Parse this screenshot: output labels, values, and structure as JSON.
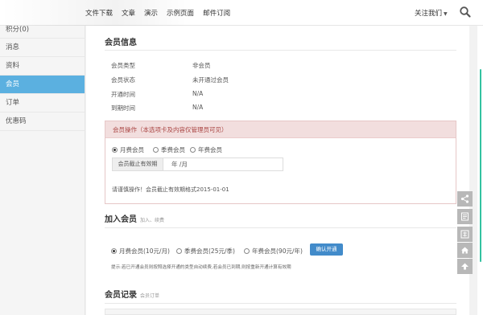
{
  "nav": {
    "items": [
      "文件下载",
      "文章",
      "演示",
      "示例页面",
      "邮件订阅"
    ],
    "follow": "关注我们"
  },
  "sidebar": {
    "items": [
      {
        "label": "积分(0)"
      },
      {
        "label": "消息"
      },
      {
        "label": "资料"
      },
      {
        "label": "会员",
        "active": true
      },
      {
        "label": "订单"
      },
      {
        "label": "优惠码"
      }
    ]
  },
  "member_info": {
    "title": "会员信息",
    "rows": [
      {
        "label": "会员类型",
        "value": "非会员"
      },
      {
        "label": "会员状态",
        "value": "未开通过会员"
      },
      {
        "label": "开通时间",
        "value": "N/A"
      },
      {
        "label": "到期时间",
        "value": "N/A"
      }
    ]
  },
  "admin": {
    "header": "会员操作（本选项卡及内容仅管理员可见）",
    "options": [
      {
        "label": "月费会员",
        "checked": true
      },
      {
        "label": "季费会员",
        "checked": false
      },
      {
        "label": "年费会员",
        "checked": false
      }
    ],
    "date_label": "会员截止有效期",
    "date_value": "年 /月",
    "hint": "请谨慎操作！会员截止有效期格式2015-01-01"
  },
  "join": {
    "title": "加入会员",
    "subtitle": "加入、续费",
    "options": [
      {
        "label": "月费会员(10元/月)",
        "checked": true
      },
      {
        "label": "季费会员(25元/季)",
        "checked": false
      },
      {
        "label": "年费会员(90元/年)",
        "checked": false
      }
    ],
    "button": "确认开通",
    "hint": "提示:若已开通会员则按照选择开通的类型自动续费,若会员已到期,则按重新开通计算有效期"
  },
  "records": {
    "title": "会员记录",
    "subtitle": "会员订单"
  },
  "float_buttons": [
    "share-icon",
    "form-icon",
    "traditional-chinese-icon",
    "home-icon",
    "back-to-top-icon"
  ],
  "colors": {
    "active_blue": "#5bb0e0",
    "primary_button": "#428bca",
    "danger_bg": "#f2dede",
    "danger_text": "#a94442",
    "scrollbar": "#33c2a0"
  }
}
